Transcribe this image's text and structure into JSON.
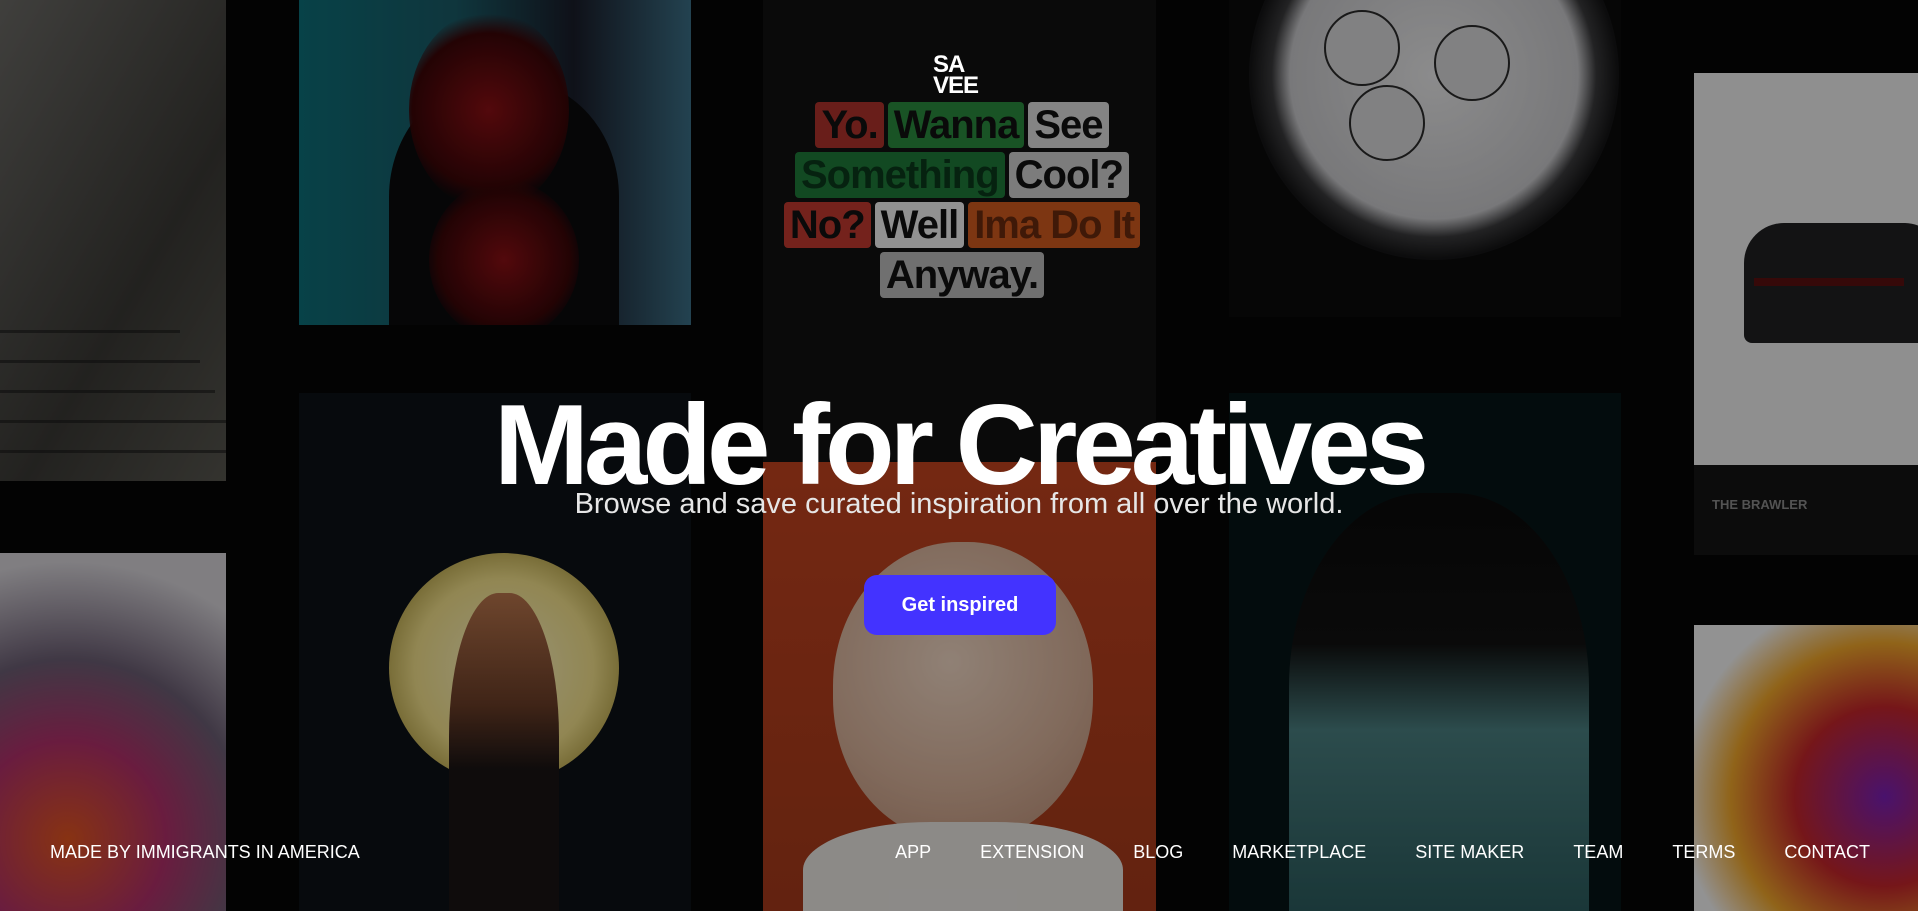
{
  "brand": {
    "logo_line1": "SA",
    "logo_line2": "VEE"
  },
  "hero": {
    "headline": "Made for Creatives",
    "subtitle": "Browse and save curated inspiration from all over the world.",
    "cta_label": "Get inspired"
  },
  "background_tiles": {
    "typography_words": [
      {
        "text": "Yo.",
        "bg": "#b0332c",
        "fg": "#111111"
      },
      {
        "text": "Wanna",
        "bg": "#2b8a3e",
        "fg": "#111111"
      },
      {
        "text": "See",
        "bg": "#dddddd",
        "fg": "#111111"
      },
      {
        "text": "Something",
        "bg": "#1f7a3a",
        "fg": "#0b3a1b"
      },
      {
        "text": "Cool?",
        "bg": "#cfcfcf",
        "fg": "#111111"
      },
      {
        "text": "No?",
        "bg": "#c23a2f",
        "fg": "#111111"
      },
      {
        "text": "Well",
        "bg": "#f2f2f2",
        "fg": "#111111"
      },
      {
        "text": "Ima Do It",
        "bg": "#d15a1e",
        "fg": "#6a2a0e"
      },
      {
        "text": "Anyway.",
        "bg": "#bbbbbb",
        "fg": "#111111"
      }
    ],
    "brawler_caption": "THE BRAWLER"
  },
  "footer": {
    "tagline": "MADE BY IMMIGRANTS IN AMERICA",
    "nav": [
      {
        "label": "APP"
      },
      {
        "label": "EXTENSION"
      },
      {
        "label": "BLOG"
      },
      {
        "label": "MARKETPLACE"
      },
      {
        "label": "SITE MAKER"
      },
      {
        "label": "TEAM"
      },
      {
        "label": "TERMS"
      },
      {
        "label": "CONTACT"
      }
    ]
  },
  "colors": {
    "accent": "#4333ff",
    "background": "#050505",
    "text": "#ffffff"
  }
}
